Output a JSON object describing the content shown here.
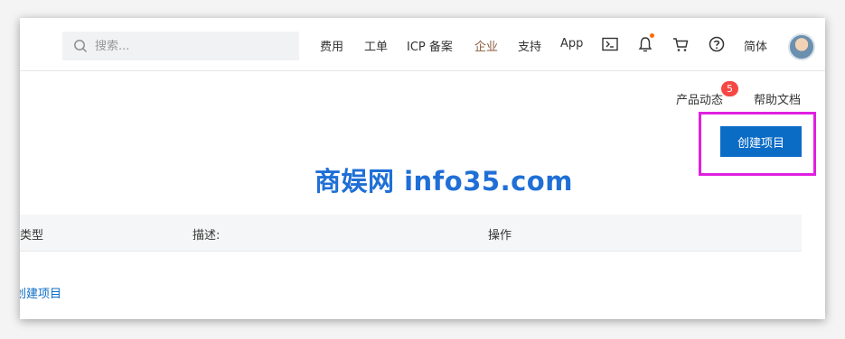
{
  "search": {
    "placeholder": "搜索..."
  },
  "nav": [
    {
      "label": "费用"
    },
    {
      "label": "工单"
    },
    {
      "label": "ICP 备案"
    },
    {
      "label": "企业"
    },
    {
      "label": "支持"
    },
    {
      "label": "App"
    }
  ],
  "header_icons": [
    "terminal-icon",
    "bell-icon",
    "cart-icon",
    "help-icon"
  ],
  "language": "简体",
  "sublinks": {
    "product_news": "产品动态",
    "product_news_count": "5",
    "help_docs": "帮助文档"
  },
  "create_button": "创建项目",
  "watermark": "商娱网 info35.com",
  "table": {
    "headers": [
      "类型",
      "描述:",
      "操作"
    ]
  },
  "create_link": "创建项目",
  "colors": {
    "primary": "#0b6cc6",
    "highlight": "#e020e0",
    "active_nav": "#8b5a3c",
    "badge": "#f54743",
    "notification_dot": "#ff6a00"
  }
}
